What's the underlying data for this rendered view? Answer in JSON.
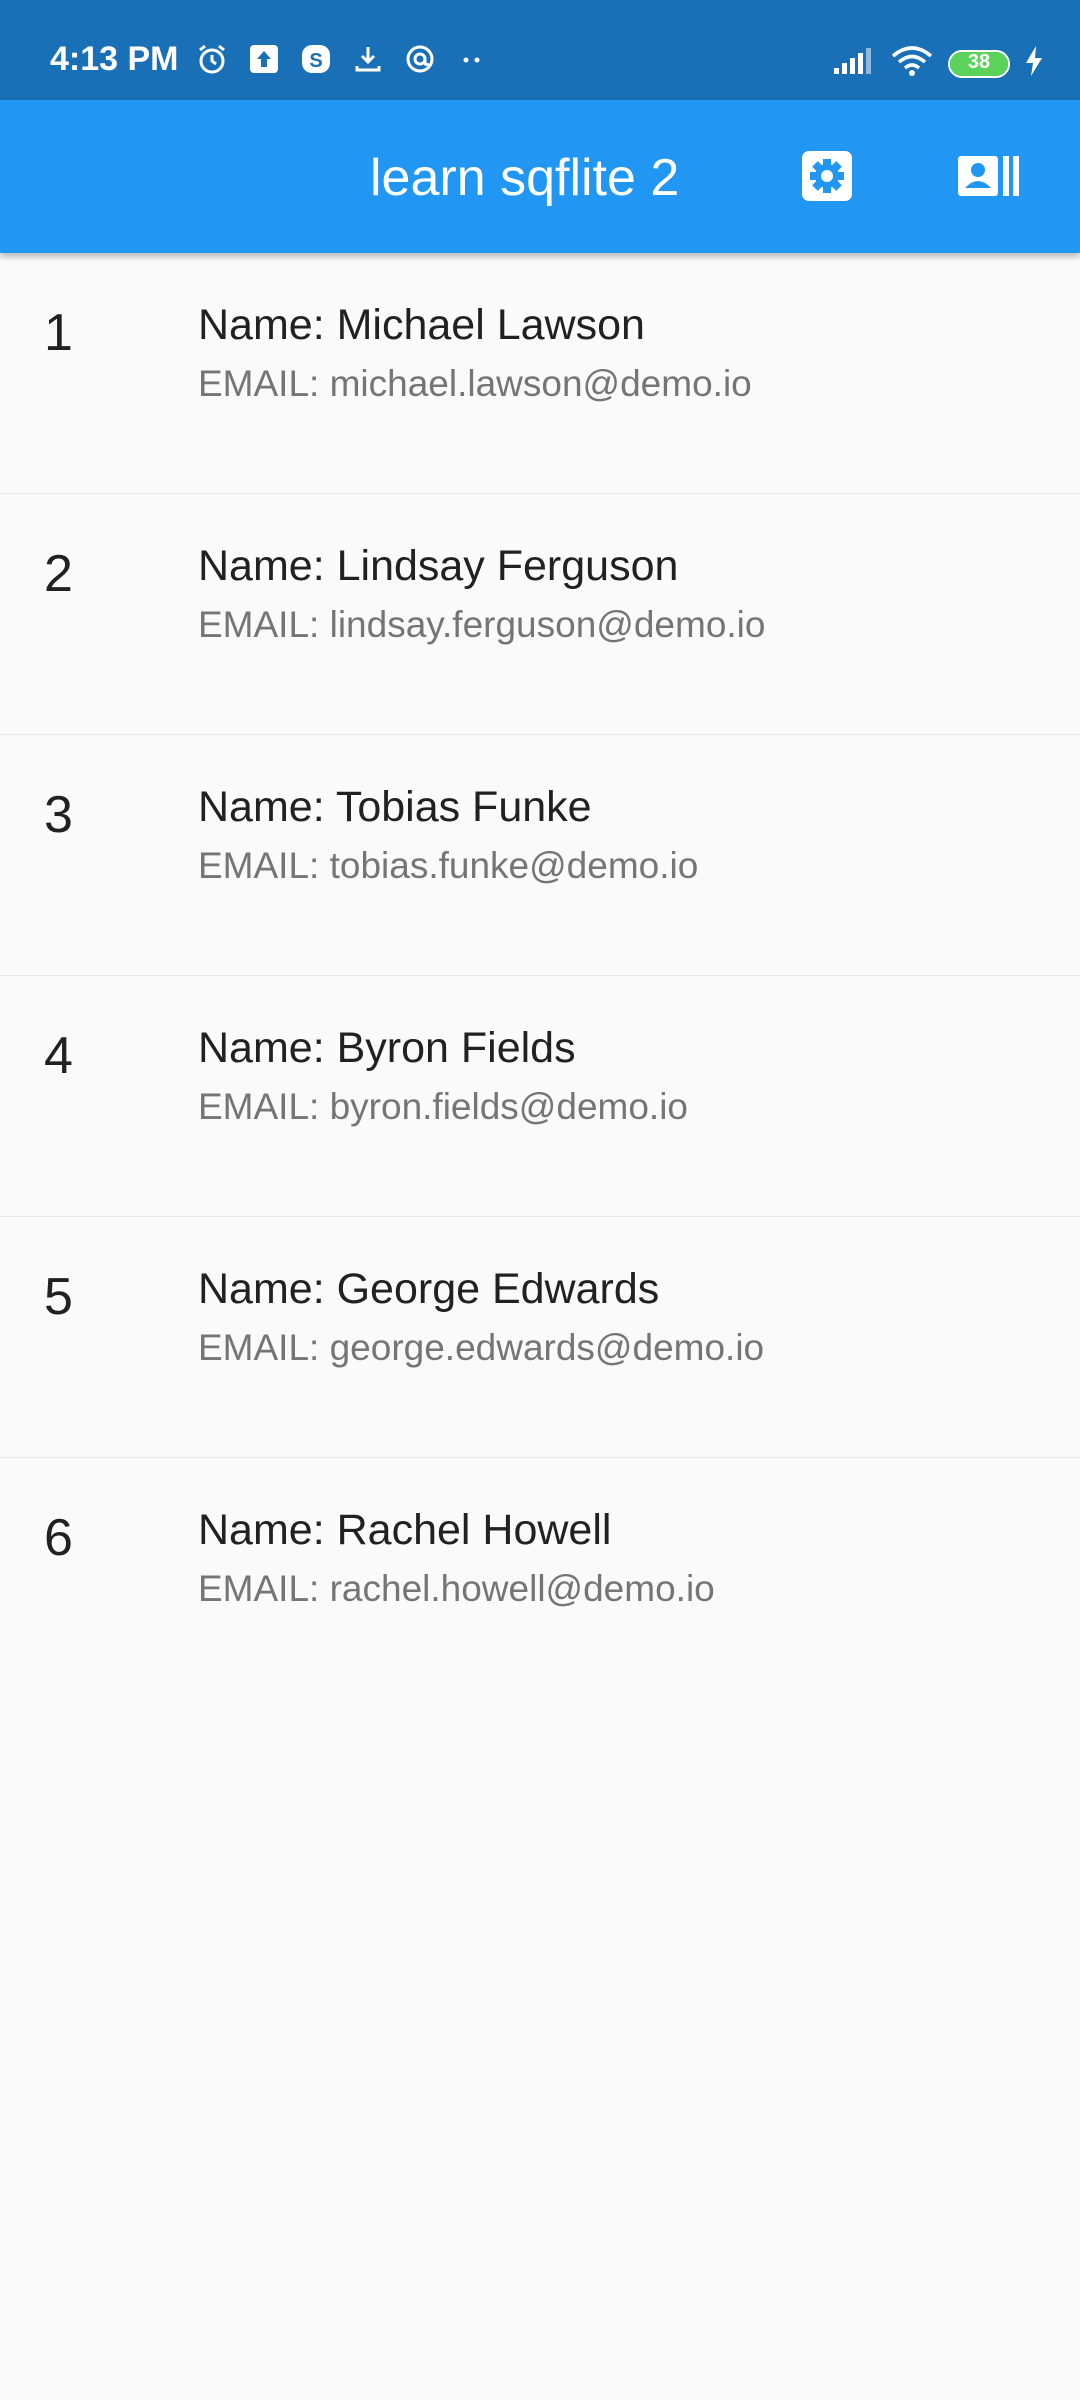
{
  "status_bar": {
    "time": "4:13 PM",
    "battery": "38",
    "left_icons": [
      "alarm-icon",
      "upload-icon",
      "skype-icon",
      "download-icon",
      "at-sign-icon",
      "more-dots-icon"
    ],
    "right_icons": [
      "signal-icon",
      "wifi-icon",
      "battery-icon",
      "charging-icon"
    ]
  },
  "app_bar": {
    "title": "learn sqflite 2",
    "actions": [
      "settings-icon",
      "contacts-icon"
    ],
    "color": "#2196f3"
  },
  "list": {
    "items": [
      {
        "id": "1",
        "name": "Name: Michael Lawson",
        "email": "EMAIL: michael.lawson@demo.io"
      },
      {
        "id": "2",
        "name": "Name: Lindsay Ferguson",
        "email": "EMAIL: lindsay.ferguson@demo.io"
      },
      {
        "id": "3",
        "name": "Name: Tobias Funke",
        "email": "EMAIL: tobias.funke@demo.io"
      },
      {
        "id": "4",
        "name": "Name: Byron Fields",
        "email": "EMAIL: byron.fields@demo.io"
      },
      {
        "id": "5",
        "name": "Name: George Edwards",
        "email": "EMAIL: george.edwards@demo.io"
      },
      {
        "id": "6",
        "name": "Name: Rachel Howell",
        "email": "EMAIL: rachel.howell@demo.io"
      }
    ]
  }
}
